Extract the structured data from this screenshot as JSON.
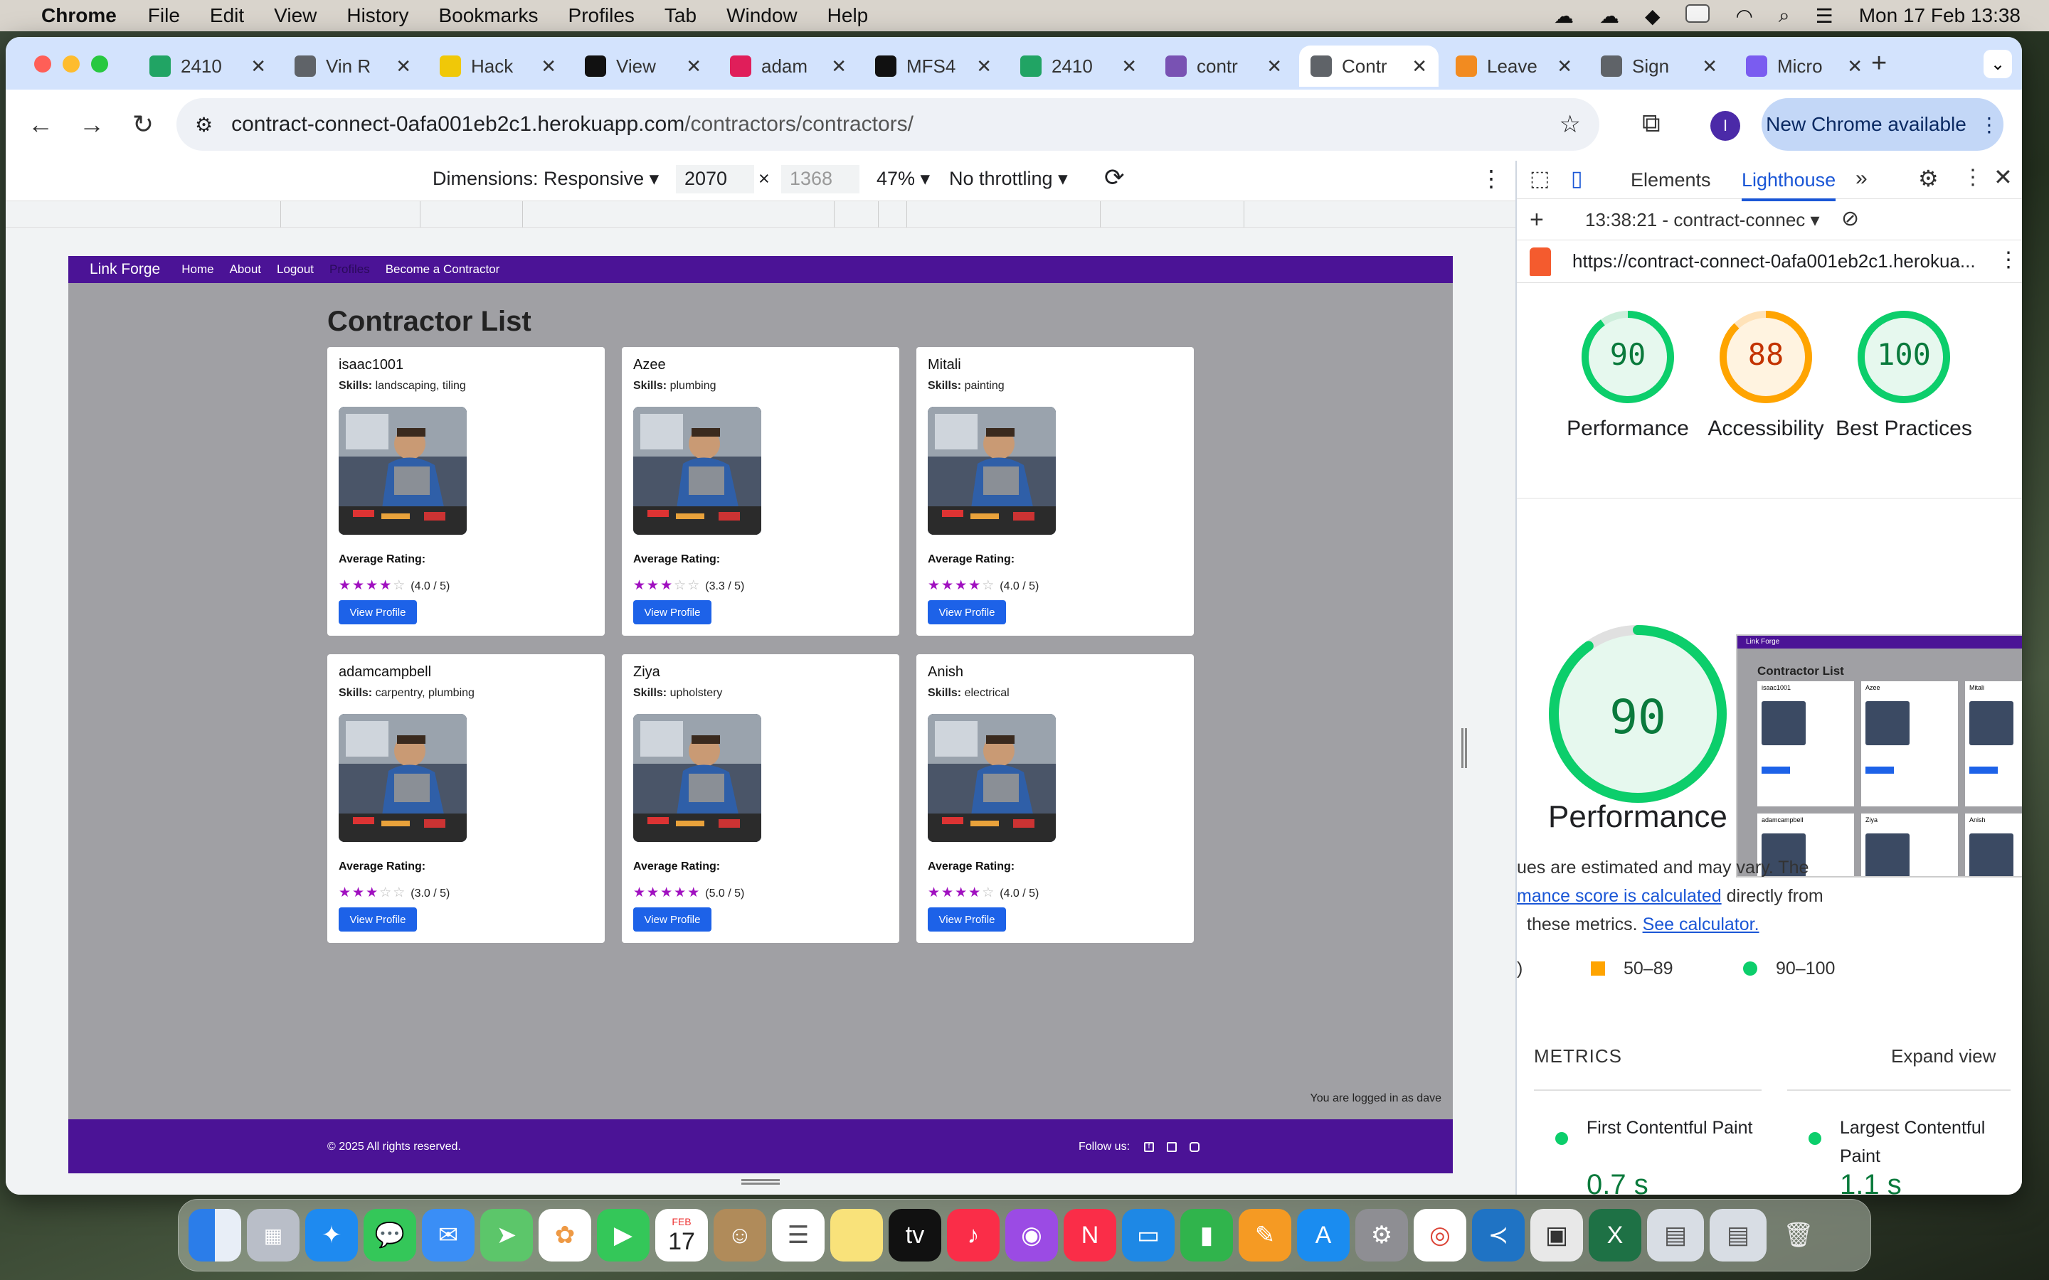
{
  "menubar": {
    "app": "Chrome",
    "items": [
      "File",
      "Edit",
      "View",
      "History",
      "Bookmarks",
      "Profiles",
      "Tab",
      "Window",
      "Help"
    ],
    "datetime": "Mon 17 Feb  13:38"
  },
  "tabs": [
    {
      "label": "2410",
      "color": "#21a464"
    },
    {
      "label": "Vin R",
      "color": "#5f6368"
    },
    {
      "label": "Hack",
      "color": "#f0c808"
    },
    {
      "label": "View",
      "color": "#111111"
    },
    {
      "label": "adam",
      "color": "#e01e5a"
    },
    {
      "label": "MFS4",
      "color": "#111111"
    },
    {
      "label": "2410",
      "color": "#21a464"
    },
    {
      "label": "contr",
      "color": "#7952b3"
    },
    {
      "label": "Contr",
      "color": "#5f6368",
      "active": true
    },
    {
      "label": "Leave",
      "color": "#f28b20"
    },
    {
      "label": "Sign",
      "color": "#5f6368"
    },
    {
      "label": "Micro",
      "color": "#7a5cf0"
    }
  ],
  "address": {
    "host": "contract-connect-0afa001eb2c1.herokuapp.com",
    "path": "/contractors/contractors/"
  },
  "new_chrome": "New Chrome available",
  "profile_initial": "I",
  "device_toolbar": {
    "dimensions": "Dimensions: Responsive",
    "width": "2070",
    "height": "1368",
    "zoom": "47%",
    "throttling": "No throttling"
  },
  "site": {
    "brand": "Link Forge",
    "nav": [
      "Home",
      "About",
      "Logout",
      "Profiles",
      "Become a Contractor"
    ],
    "title": "Contractor List",
    "rating_label": "Average Rating:",
    "skills_label": "Skills:",
    "view_button": "View Profile",
    "logged_in": "You are logged in as dave",
    "footer_copy": "© 2025 All rights reserved.",
    "follow": "Follow us:",
    "contractors": [
      {
        "name": "isaac1001",
        "skills": "landscaping, tiling",
        "rating": 4,
        "rating_text": "(4.0 / 5)"
      },
      {
        "name": "Azee",
        "skills": "plumbing",
        "rating": 3,
        "rating_text": "(3.3 / 5)"
      },
      {
        "name": "Mitali",
        "skills": "painting",
        "rating": 4,
        "rating_text": "(4.0 / 5)"
      },
      {
        "name": "adamcampbell",
        "skills": "carpentry, plumbing",
        "rating": 3,
        "rating_text": "(3.0 / 5)"
      },
      {
        "name": "Ziya",
        "skills": "upholstery",
        "rating": 5,
        "rating_text": "(5.0 / 5)"
      },
      {
        "name": "Anish",
        "skills": "electrical",
        "rating": 4,
        "rating_text": "(4.0 / 5)"
      }
    ]
  },
  "devtools": {
    "tabs": [
      "Elements",
      "Lighthouse"
    ],
    "report_time": "13:38:21 - contract-connec",
    "report_url": "https://contract-connect-0afa001eb2c1.herokua...",
    "scores": [
      {
        "label": "Performance",
        "value": 90,
        "color": "#0cce6b",
        "text_color": "#0a7a3c"
      },
      {
        "label": "Accessibility",
        "value": 88,
        "color": "#ffa400",
        "text_color": "#c33300"
      },
      {
        "label": "Best Practices",
        "value": 100,
        "color": "#0cce6b",
        "text_color": "#0a7a3c"
      }
    ],
    "big_score": "90",
    "big_label": "Performance",
    "note_1": "ues are estimated and may vary. The",
    "note_link": "mance score is calculated",
    "note_2": " directly from",
    "note_3": "these metrics.",
    "calc_link": "See calculator.",
    "legend_mid": "50–89",
    "legend_high": "90–100",
    "metrics_label": "METRICS",
    "expand": "Expand view",
    "metric_1": "First Contentful Paint",
    "metric_1_value": "0.7 s",
    "metric_2": "Largest Contentful Paint",
    "metric_2_value": "1.1 s",
    "thumb_brand": "Link Forge",
    "thumb_title": "Contractor List"
  },
  "dock_date": {
    "month": "FEB",
    "day": "17"
  }
}
